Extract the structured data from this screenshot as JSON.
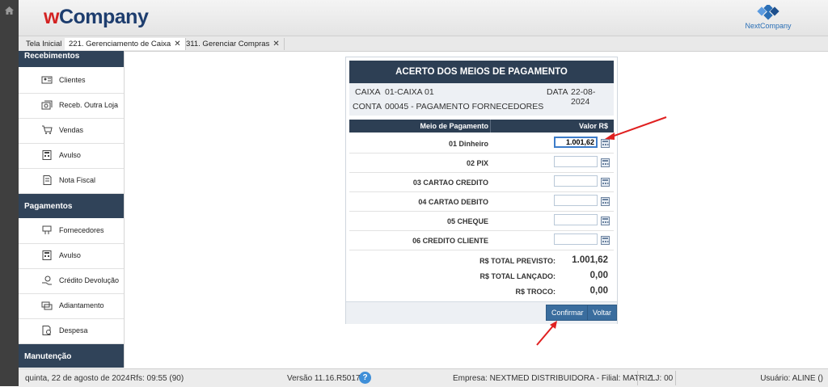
{
  "header": {
    "logo_w": "w",
    "logo_rest": "Company",
    "partner_logo": "NextCompany"
  },
  "tabs": [
    {
      "label": "Tela Inicial"
    },
    {
      "label": "221. Gerenciamento de Caixa",
      "close": "✕"
    },
    {
      "label": "311. Gerenciar Compras",
      "close": "✕"
    }
  ],
  "sidebar": {
    "sections": [
      {
        "title": "Recebimentos",
        "items": [
          {
            "label": "Clientes",
            "icon": "clients-icon"
          },
          {
            "label": "Receb. Outra Loja",
            "icon": "store-receipt-icon"
          },
          {
            "label": "Vendas",
            "icon": "cart-icon"
          },
          {
            "label": "Avulso",
            "icon": "calculator-icon"
          },
          {
            "label": "Nota Fiscal",
            "icon": "invoice-icon"
          }
        ]
      },
      {
        "title": "Pagamentos",
        "items": [
          {
            "label": "Fornecedores",
            "icon": "supplier-icon"
          },
          {
            "label": "Avulso",
            "icon": "calculator-icon"
          },
          {
            "label": "Crédito Devolução",
            "icon": "credit-return-icon"
          },
          {
            "label": "Adiantamento",
            "icon": "advance-icon"
          },
          {
            "label": "Despesa",
            "icon": "expense-icon"
          }
        ]
      },
      {
        "title": "Manutenção",
        "items": []
      }
    ]
  },
  "panel": {
    "title": "ACERTO DOS MEIOS DE PAGAMENTO",
    "caixa_label": "CAIXA",
    "caixa_value": "01-CAIXA 01",
    "data_label": "DATA",
    "data_value": "22-08-2024",
    "conta_label": "CONTA",
    "conta_value": "00045 - PAGAMENTO FORNECEDORES",
    "col_meio": "Meio de Pagamento",
    "col_valor": "Valor R$",
    "rows": [
      {
        "name": "01 Dinheiro",
        "value": "1.001,62"
      },
      {
        "name": "02 PIX",
        "value": ""
      },
      {
        "name": "03 CARTAO CREDITO",
        "value": ""
      },
      {
        "name": "04 CARTAO DEBITO",
        "value": ""
      },
      {
        "name": "05 CHEQUE",
        "value": ""
      },
      {
        "name": "06 CREDITO CLIENTE",
        "value": ""
      }
    ],
    "totals": [
      {
        "label": "R$ TOTAL PREVISTO:",
        "value": "1.001,62"
      },
      {
        "label": "R$ TOTAL LANÇADO:",
        "value": "0,00"
      },
      {
        "label": "R$ TROCO:",
        "value": "0,00"
      }
    ],
    "confirm_label": "Confirmar",
    "back_label": "Voltar"
  },
  "footer": {
    "date": "quinta, 22 de agosto de 2024",
    "rfs": "Rfs: 09:55 (90)",
    "version": "Versão 11.16.R5017",
    "help": "?",
    "empresa": "Empresa: NEXTMED DISTRIBUIDORA - Filial: MATRIZ",
    "loja": "LJ: 00",
    "usuario": "Usuário: ALINE ()"
  },
  "colors": {
    "nav_dark": "#304359",
    "button": "#3a6d9e",
    "annotation": "#e02020"
  }
}
